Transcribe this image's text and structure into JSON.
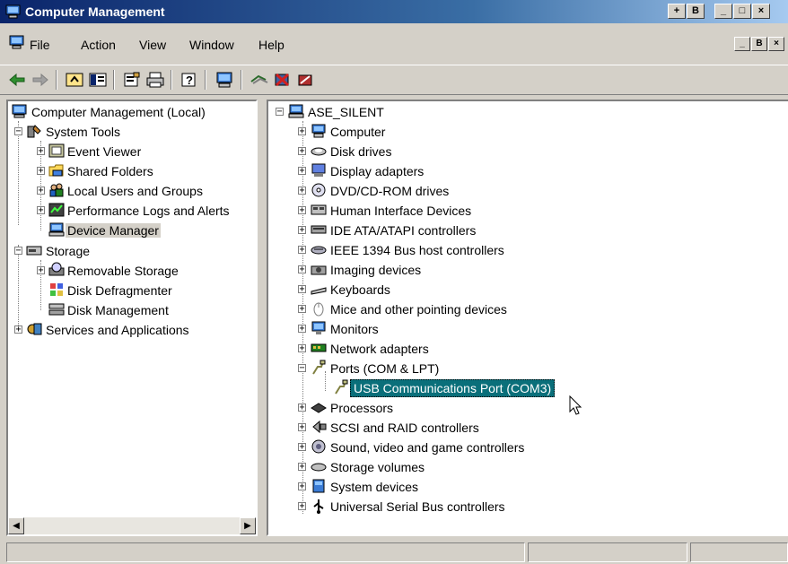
{
  "window": {
    "title": "Computer Management",
    "caption_buttons": [
      "+",
      "B",
      "_",
      "□",
      "×"
    ]
  },
  "menu": {
    "items": [
      "File",
      "Action",
      "View",
      "Window",
      "Help"
    ],
    "mdi_buttons": [
      "_",
      "B",
      "×"
    ]
  },
  "toolbar": {
    "buttons": [
      "back-icon",
      "forward-icon",
      "up-level-icon",
      "show-hide-tree-icon",
      "properties-icon",
      "print-icon",
      "help-icon",
      "computer-icon",
      "scan-hardware-icon",
      "uninstall-icon",
      "disable-icon"
    ]
  },
  "left_tree": {
    "root": "Computer Management (Local)",
    "system_tools": "System Tools",
    "event_viewer": "Event Viewer",
    "shared_folders": "Shared Folders",
    "local_users": "Local Users and Groups",
    "perf_logs": "Performance Logs and Alerts",
    "device_manager": "Device Manager",
    "storage": "Storage",
    "removable_storage": "Removable Storage",
    "disk_defrag": "Disk Defragmenter",
    "disk_mgmt": "Disk Management",
    "services_apps": "Services and Applications"
  },
  "right_tree": {
    "root": "ASE_SILENT",
    "items": [
      {
        "label": "Computer",
        "icon": "computer-icon"
      },
      {
        "label": "Disk drives",
        "icon": "disk-drive-icon"
      },
      {
        "label": "Display adapters",
        "icon": "display-adapter-icon"
      },
      {
        "label": "DVD/CD-ROM drives",
        "icon": "cdrom-icon"
      },
      {
        "label": "Human Interface Devices",
        "icon": "hid-icon"
      },
      {
        "label": "IDE ATA/ATAPI controllers",
        "icon": "ide-icon"
      },
      {
        "label": "IEEE 1394 Bus host controllers",
        "icon": "ieee1394-icon"
      },
      {
        "label": "Imaging devices",
        "icon": "imaging-icon"
      },
      {
        "label": "Keyboards",
        "icon": "keyboard-icon"
      },
      {
        "label": "Mice and other pointing devices",
        "icon": "mouse-icon"
      },
      {
        "label": "Monitors",
        "icon": "monitor-icon"
      },
      {
        "label": "Network adapters",
        "icon": "network-adapter-icon"
      },
      {
        "label": "Ports (COM & LPT)",
        "icon": "port-icon"
      },
      {
        "label": "USB Communications Port (COM3)",
        "icon": "port-icon"
      },
      {
        "label": "Processors",
        "icon": "processor-icon"
      },
      {
        "label": "SCSI and RAID controllers",
        "icon": "scsi-icon"
      },
      {
        "label": "Sound, video and game controllers",
        "icon": "sound-icon"
      },
      {
        "label": "Storage volumes",
        "icon": "storage-volume-icon"
      },
      {
        "label": "System devices",
        "icon": "system-device-icon"
      },
      {
        "label": "Universal Serial Bus controllers",
        "icon": "usb-icon"
      }
    ]
  },
  "colors": {
    "title_start": "#0a246a",
    "title_end": "#a6caf0",
    "selection": "#0a6f7a",
    "face": "#d4d0c8"
  }
}
